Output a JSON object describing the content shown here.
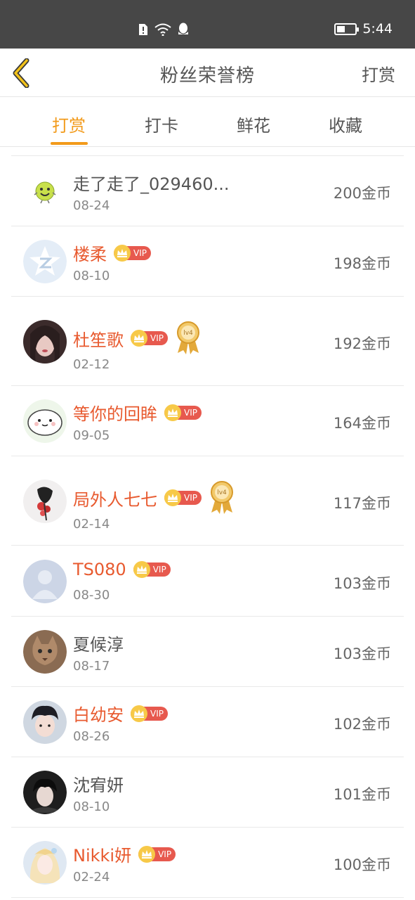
{
  "status": {
    "time": "5:44",
    "icons": [
      "sim-alert-icon",
      "wifi-icon",
      "qq-icon",
      "battery-icon"
    ],
    "battery_level": 0.45
  },
  "header": {
    "title": "粉丝荣誉榜",
    "action_label": "打赏",
    "back_icon": "chevron-left-icon"
  },
  "tabs": [
    "打赏",
    "打卡",
    "鲜花",
    "收藏"
  ],
  "active_tab": "打赏",
  "badges": {
    "vip_label": "VIP",
    "level_label": "lv4"
  },
  "colors": {
    "accent": "#f29a1a",
    "vip_name": "#e85a2f",
    "vip_badge": "#e7594e"
  },
  "list": [
    {
      "name": "走了走了_029460...",
      "date": "08-24",
      "coins": "200金币",
      "vip": false,
      "level": false
    },
    {
      "name": "楼柔",
      "date": "08-10",
      "coins": "198金币",
      "vip": true,
      "level": false
    },
    {
      "name": "杜笙歌",
      "date": "02-12",
      "coins": "192金币",
      "vip": true,
      "level": true
    },
    {
      "name": "等你的回眸",
      "date": "09-05",
      "coins": "164金币",
      "vip": true,
      "level": false
    },
    {
      "name": "局外人七七",
      "date": "02-14",
      "coins": "117金币",
      "vip": true,
      "level": true
    },
    {
      "name": "TS080",
      "date": "08-30",
      "coins": "103金币",
      "vip": true,
      "level": false
    },
    {
      "name": "夏候淳",
      "date": "08-17",
      "coins": "103金币",
      "vip": false,
      "level": false
    },
    {
      "name": "白幼安",
      "date": "08-26",
      "coins": "102金币",
      "vip": true,
      "level": false
    },
    {
      "name": "沈宥妍",
      "date": "08-10",
      "coins": "101金币",
      "vip": false,
      "level": false
    },
    {
      "name": "Nikki妍",
      "date": "02-24",
      "coins": "100金币",
      "vip": true,
      "level": false
    }
  ]
}
